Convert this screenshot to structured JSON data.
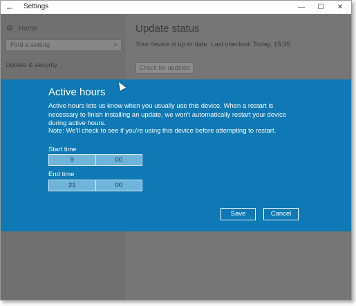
{
  "window": {
    "title": "Settings",
    "back_glyph": "←",
    "minimize_glyph": "—",
    "maximize_glyph": "☐",
    "close_glyph": "✕"
  },
  "sidebar": {
    "home_label": "Home",
    "home_icon": "gear-icon",
    "search_placeholder": "Find a setting",
    "search_icon": "search-icon",
    "nav_item": "Update & security"
  },
  "main": {
    "title": "Update status",
    "status_text": "Your device is up to date. Last checked: Today, 15:35",
    "check_button": "Check for updates"
  },
  "dialog": {
    "title": "Active hours",
    "body": "Active hours lets us know when you usually use this device. When a restart is necessary to finish installing an update, we won't automatically restart your device during active hours.",
    "note": "Note: We'll check to see if you're using this device before attempting to restart.",
    "start_label": "Start time",
    "start_hour": "9",
    "start_minute": "00",
    "end_label": "End time",
    "end_hour": "21",
    "end_minute": "00",
    "save_label": "Save",
    "cancel_label": "Cancel"
  },
  "colors": {
    "dialog_bg": "#0e79b4",
    "overlay_gray": "#767676",
    "time_field_bg": "#6fb4db"
  }
}
